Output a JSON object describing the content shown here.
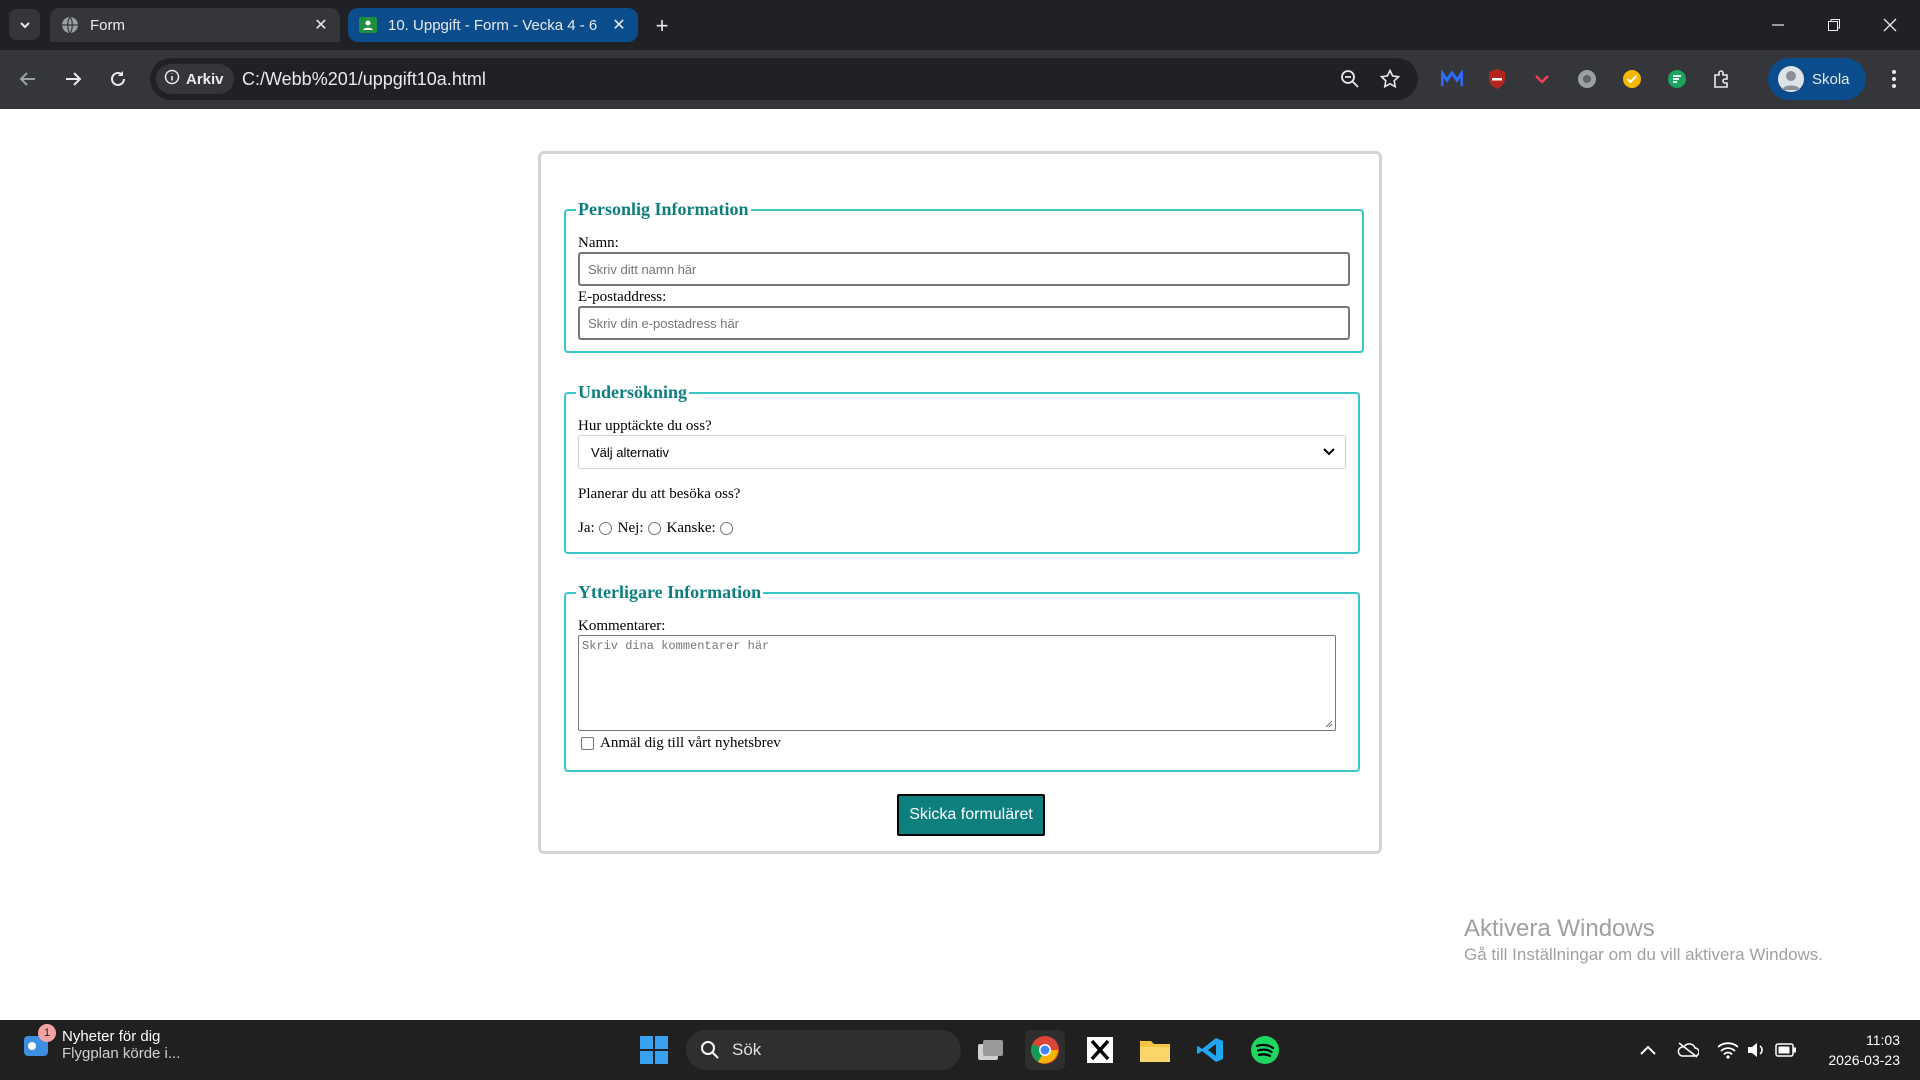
{
  "browser": {
    "tabs": [
      {
        "title": "Form",
        "active": true
      },
      {
        "title": "10. Uppgift - Form - Vecka 4 - 6",
        "active": false
      }
    ],
    "new_tab": "+",
    "address": {
      "chip_label": "Arkiv",
      "url": "C:/Webb%201/uppgift10a.html"
    },
    "profile_name": "Skola"
  },
  "form": {
    "personal": {
      "legend": "Personlig Information",
      "name_label": "Namn:",
      "name_placeholder": "Skriv ditt namn här",
      "email_label": "E-postaddress:",
      "email_placeholder": "Skriv din e-postadress här"
    },
    "survey": {
      "legend": "Undersökning",
      "source_label": "Hur upptäckte du oss?",
      "source_selected": "Välj alternativ",
      "visit_question": "Planerar du att besöka oss?",
      "options": [
        "Ja:",
        "Nej:",
        "Kanske:"
      ]
    },
    "extra": {
      "legend": "Ytterligare Information",
      "comments_label": "Kommentarer:",
      "comments_placeholder": "Skriv dina kommentarer här",
      "newsletter_label": "Anmäl dig till vårt nyhetsbrev"
    },
    "submit_label": "Skicka formuläret"
  },
  "watermark": {
    "title": "Aktivera Windows",
    "subtitle": "Gå till Inställningar om du vill aktivera Windows."
  },
  "taskbar": {
    "news_badge": "1",
    "news_title": "Nyheter för dig",
    "news_headline": "Flygplan körde i...",
    "search_label": "Sök",
    "time": "11:03",
    "date": "2026-03-23"
  },
  "colors": {
    "accent": "#0e7f7f",
    "fieldset_border": "#38c6c6",
    "tab_active_bg": "#0b4c8c"
  }
}
